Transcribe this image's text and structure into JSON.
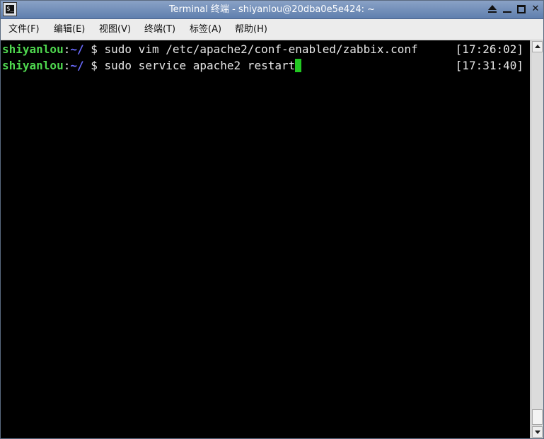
{
  "window": {
    "title": "Terminal 终端 - shiyanlou@20dba0e5e424: ~",
    "app_icon_glyph": "$_",
    "controls": [
      "shade-icon",
      "minimize-icon",
      "maximize-icon",
      "close-icon"
    ],
    "close_glyph": "✕"
  },
  "menu": {
    "items": [
      {
        "label": "文件(F)"
      },
      {
        "label": "编辑(E)"
      },
      {
        "label": "视图(V)"
      },
      {
        "label": "终端(T)"
      },
      {
        "label": "标签(A)"
      },
      {
        "label": "帮助(H)"
      }
    ]
  },
  "terminal": {
    "colors": {
      "background": "#000000",
      "user": "#4fd84f",
      "path": "#6b6bff",
      "text": "#e6e6e6",
      "cursor": "#22c722"
    },
    "lines": [
      {
        "user": "shiyanlou",
        "colon": ":",
        "path": "~/",
        "prompt": " $ ",
        "command": "sudo vim /etc/apache2/conf-enabled/zabbix.conf",
        "time": "[17:26:02]"
      },
      {
        "user": "shiyanlou",
        "colon": ":",
        "path": "~/",
        "prompt": " $ ",
        "command": "sudo service apache2 restart",
        "time": "[17:31:40]"
      }
    ]
  }
}
